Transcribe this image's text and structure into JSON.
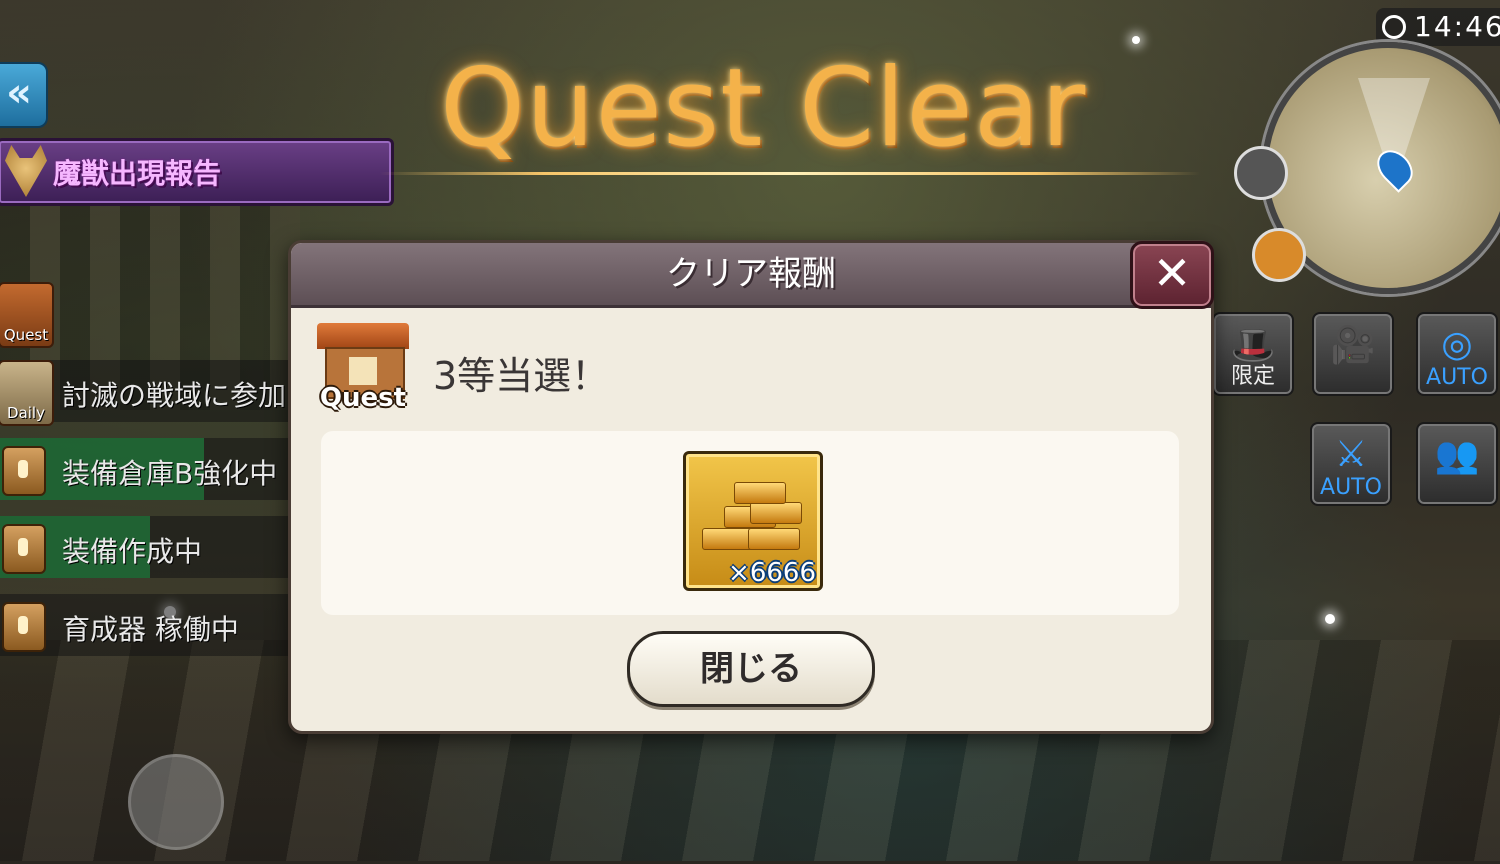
{
  "title": "Quest Clear",
  "clock": {
    "time": "14:46",
    "icon": "clock-icon"
  },
  "top_left": {
    "beast_report_label": "魔獣出現報告",
    "back_icon": "rewind-icon"
  },
  "quest_list": [
    {
      "icon_label": "Quest",
      "text": ""
    },
    {
      "icon_label": "Daily",
      "text": "討滅の戦域に参加",
      "progress": 0
    },
    {
      "icon_label": "",
      "text": "装備倉庫B強化中",
      "progress": 0.68
    },
    {
      "icon_label": "",
      "text": "装備作成中",
      "progress": 0.5
    },
    {
      "icon_label": "",
      "text": "育成器 稼働中",
      "progress": 0
    }
  ],
  "hud_buttons": [
    {
      "name": "limited",
      "label": "限定",
      "icon": "hat-icon"
    },
    {
      "name": "camera",
      "label": "",
      "icon": "camera-icon"
    },
    {
      "name": "auto",
      "label": "AUTO",
      "icon": "auto-target-icon"
    },
    {
      "name": "auto-x2",
      "label": "AUTO",
      "icon": "sword-x2-icon"
    },
    {
      "name": "party",
      "label": "",
      "icon": "group-icon"
    }
  ],
  "dialog": {
    "title": "クリア報酬",
    "close_icon": "close-icon",
    "badge_label": "Quest",
    "result_text": "3等当選！",
    "reward": {
      "icon": "gold-bars-icon",
      "quantity": "×6666"
    },
    "close_button": "閉じる"
  },
  "colors": {
    "title_gold": "#f4b24a",
    "dialog_bg": "#f1ece0",
    "header_bg": "#6e6066",
    "progress_green": "#1f9a4a"
  }
}
